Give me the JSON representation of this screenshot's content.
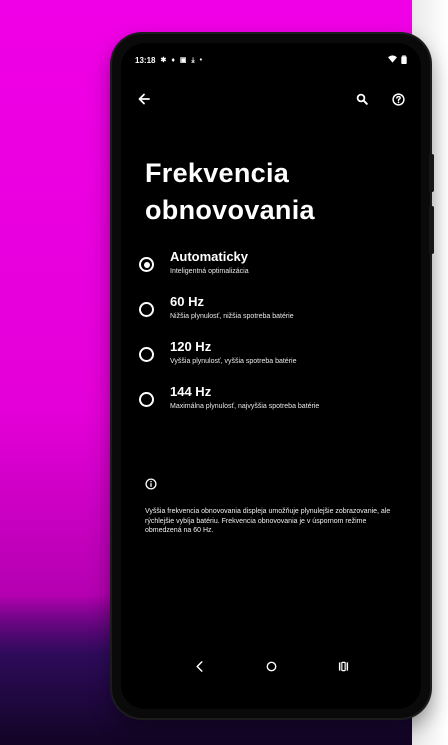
{
  "status_bar": {
    "time": "13:18",
    "icons": [
      "settings-gear",
      "fire-icon",
      "gallery-icon",
      "download-icon",
      "notification-dot"
    ],
    "right_icons": [
      "wifi-icon",
      "battery-icon"
    ]
  },
  "app_bar": {
    "back_icon": "arrow-back",
    "search_icon": "search",
    "help_icon": "help"
  },
  "page": {
    "title": "Frekvencia obnovovania"
  },
  "options": [
    {
      "label": "Automaticky",
      "description": "Inteligentná optimalizácia",
      "selected": true
    },
    {
      "label": "60 Hz",
      "description": "Nižšia plynulosť, nižšia spotreba batérie",
      "selected": false
    },
    {
      "label": "120 Hz",
      "description": "Vyššia plynulosť, vyššia spotreba batérie",
      "selected": false
    },
    {
      "label": "144 Hz",
      "description": "Maximálna plynulosť, najvyššia spotreba batérie",
      "selected": false
    }
  ],
  "info": {
    "icon": "info-outline",
    "text": "Vyššia frekvencia obnovovania displeja umožňuje plynulejšie zobrazovanie, ale rýchlejšie vybíja batériu. Frekvencia obnovovania je v úspornom režime obmedzená na 60 Hz."
  },
  "nav_bar": {
    "back": "nav-back",
    "home": "nav-home",
    "recents": "nav-recents"
  },
  "colors": {
    "background_magenta": "#f000e6",
    "screen_bg": "#000000",
    "text": "#ffffff"
  }
}
